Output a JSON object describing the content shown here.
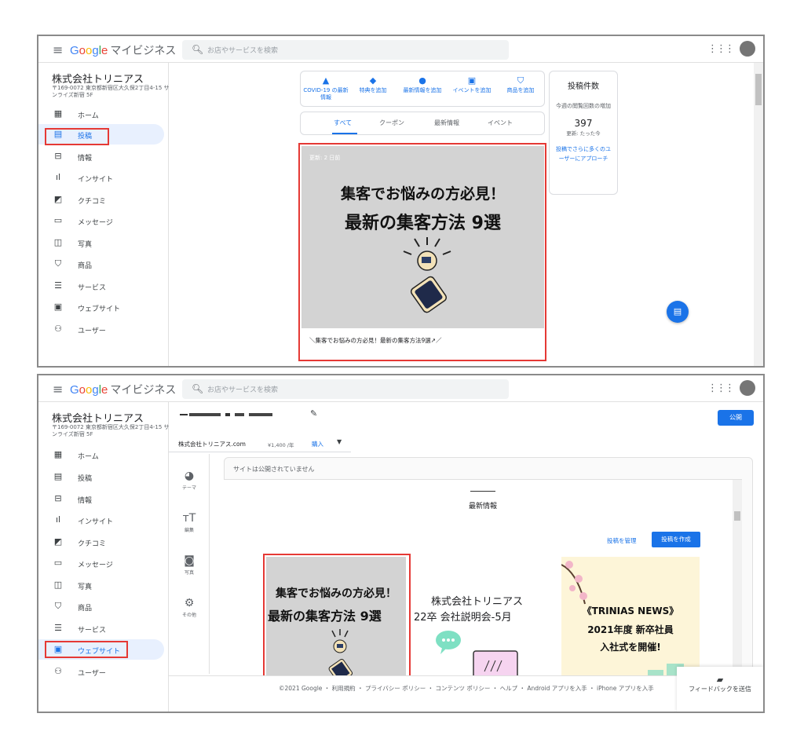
{
  "app": {
    "logo_parts": [
      "G",
      "o",
      "o",
      "g",
      "l",
      "e"
    ],
    "product": "マイビジネス",
    "search_placeholder": "お店やサービスを検索",
    "business_name": "株式会社トリニアス",
    "business_address": "〒169-0072 東京都新宿区大久保2丁目4-15 サンライズ新宿 5F"
  },
  "nav_items": [
    {
      "label": "ホーム",
      "icon": "dashboard-icon"
    },
    {
      "label": "投稿",
      "icon": "post-icon"
    },
    {
      "label": "情報",
      "icon": "store-icon"
    },
    {
      "label": "インサイト",
      "icon": "bar-chart-icon"
    },
    {
      "label": "クチコミ",
      "icon": "review-icon"
    },
    {
      "label": "メッセージ",
      "icon": "message-icon"
    },
    {
      "label": "写真",
      "icon": "photo-icon"
    },
    {
      "label": "商品",
      "icon": "basket-icon"
    },
    {
      "label": "サービス",
      "icon": "list-icon"
    },
    {
      "label": "ウェブサイト",
      "icon": "website-icon"
    },
    {
      "label": "ユーザー",
      "icon": "add-user-icon"
    }
  ],
  "screen1": {
    "selected_nav": "投稿",
    "actions": [
      {
        "label": "COVID-19 の最新情報",
        "icon": "warning-icon"
      },
      {
        "label": "特典を追加",
        "icon": "tag-icon"
      },
      {
        "label": "最新情報を追加",
        "icon": "news-icon"
      },
      {
        "label": "イベントを追加",
        "icon": "calendar-icon"
      },
      {
        "label": "商品を追加",
        "icon": "basket-icon"
      }
    ],
    "tabs": [
      "すべて",
      "クーポン",
      "最新情報",
      "イベント"
    ],
    "active_tab": "すべて",
    "stats": {
      "title": "投稿件数",
      "subtitle": "今週の閲覧回数の増加",
      "count": "397",
      "updated": "更新: たった今",
      "link": "投稿でさらに多くのユーザーにアプローチ"
    },
    "post": {
      "updated": "更新: 2 日前",
      "headline1": "集客でお悩みの方必見！",
      "headline2": "最新の集客方法 9選",
      "caption": "＼集客でお悩みの方必見！最新の集客方法9選↗／"
    }
  },
  "screen2": {
    "selected_nav": "ウェブサイト",
    "publish_label": "公開",
    "domain": "株式会社トリニアス.com",
    "price": "¥1,400 /年",
    "buy_label": "購入",
    "tools": [
      {
        "label": "テーマ",
        "icon": "palette-icon"
      },
      {
        "label": "編集",
        "icon": "text-size-icon"
      },
      {
        "label": "写真",
        "icon": "add-photo-icon"
      },
      {
        "label": "その他",
        "icon": "settings-icon"
      }
    ],
    "not_published": "サイトは公開されていません",
    "section_title": "最新情報",
    "manage_posts": "投稿を管理",
    "create_post": "投稿を作成",
    "card1_line1": "集客でお悩みの方必見！",
    "card1_line2": "最新の集客方法 9選",
    "card2_line1": "株式会社トリニアス",
    "card2_line2": "22卒 会社説明会-5月",
    "card3_line1": "《TRINIAS NEWS》",
    "card3_line2": "2021年度 新卒社員",
    "card3_line3": "入社式を開催!",
    "footer_text": "©2021 Google ・ 利用規約 ・ プライバシー ポリシー ・ コンテンツ ポリシー ・ ヘルプ ・ Android アプリを入手 ・ iPhone アプリを入手",
    "feedback_label": "フィードバックを送信"
  }
}
